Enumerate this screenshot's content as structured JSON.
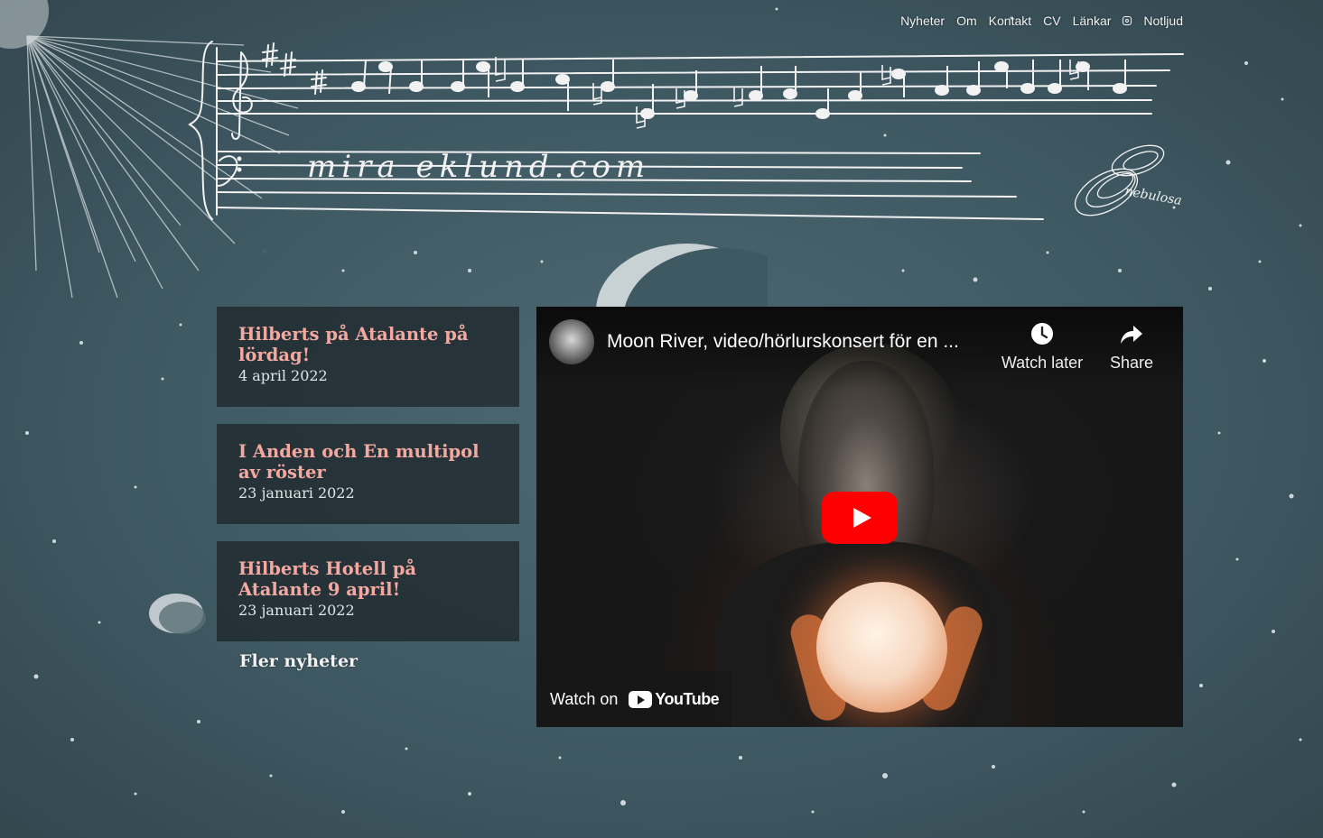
{
  "nav": {
    "items": [
      {
        "label": "Nyheter"
      },
      {
        "label": "Om"
      },
      {
        "label": "Kontakt"
      },
      {
        "label": "CV"
      },
      {
        "label": "Länkar"
      }
    ],
    "notljud_label": "Notljud"
  },
  "header": {
    "site_name": "mira eklund.com",
    "logo_text": "nebulosa"
  },
  "news": {
    "items": [
      {
        "title": "Hilberts på Atalante på lördag!",
        "date": "4 april 2022"
      },
      {
        "title": "I Anden och En multipol av röster",
        "date": "23 januari 2022"
      },
      {
        "title": "Hilberts Hotell på Atalante 9 april!",
        "date": "23 januari 2022"
      }
    ],
    "more_label": "Fler nyheter"
  },
  "video": {
    "title": "Moon River, video/hörlurskonsert för en ...",
    "watch_later": "Watch later",
    "share": "Share",
    "watch_on": "Watch on",
    "youtube": "YouTube"
  },
  "colors": {
    "news_title": "#f5a8a0",
    "youtube_red": "#ff0000"
  }
}
